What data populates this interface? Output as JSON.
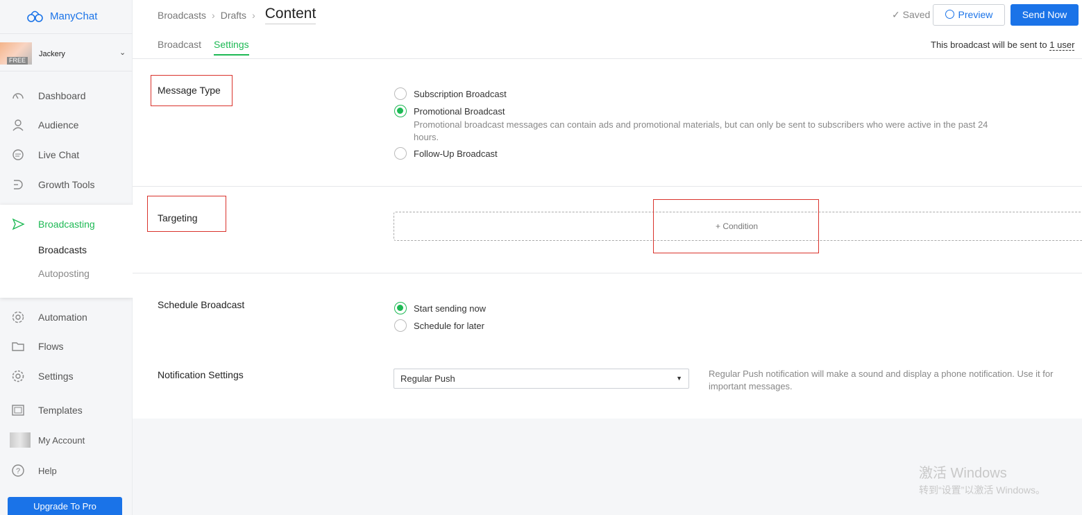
{
  "brand": {
    "name": "ManyChat",
    "color": "#1a73e8"
  },
  "account": {
    "name": "Jackery",
    "plan_badge": "FREE"
  },
  "sidebar": {
    "items": [
      {
        "label": "Dashboard",
        "icon": "dashboard-icon"
      },
      {
        "label": "Audience",
        "icon": "user-icon"
      },
      {
        "label": "Live Chat",
        "icon": "chat-icon"
      },
      {
        "label": "Growth Tools",
        "icon": "growth-tools-icon"
      },
      {
        "label": "Broadcasting",
        "icon": "send-icon"
      },
      {
        "label": "Automation",
        "icon": "automation-icon"
      },
      {
        "label": "Flows",
        "icon": "folder-icon"
      },
      {
        "label": "Settings",
        "icon": "gear-icon"
      },
      {
        "label": "Templates",
        "icon": "templates-icon"
      },
      {
        "label": "My Account",
        "icon": "account-avatar-icon"
      },
      {
        "label": "Help",
        "icon": "help-icon"
      }
    ],
    "broadcasting_sub": [
      "Broadcasts",
      "Autoposting"
    ],
    "upgrade_label": "Upgrade To Pro"
  },
  "header": {
    "breadcrumb": [
      "Broadcasts",
      "Drafts"
    ],
    "current": "Content",
    "tabs": [
      "Broadcast",
      "Settings"
    ],
    "active_tab": "Settings",
    "saved_label": "Saved",
    "preview_label": "Preview",
    "send_label": "Send Now",
    "sent_to_prefix": "This broadcast will be sent to",
    "sent_to_value": "1 user"
  },
  "message_type": {
    "label": "Message Type",
    "options": [
      "Subscription Broadcast",
      "Promotional Broadcast",
      "Follow-Up Broadcast"
    ],
    "selected": "Promotional Broadcast",
    "promo_desc": "Promotional broadcast messages can contain ads and promotional materials, but can only be sent to subscribers who were active in the past 24 hours."
  },
  "targeting": {
    "label": "Targeting",
    "condition_label": "+ Condition"
  },
  "schedule": {
    "label": "Schedule Broadcast",
    "options": [
      "Start sending now",
      "Schedule for later"
    ],
    "selected": "Start sending now"
  },
  "notification": {
    "label": "Notification Settings",
    "value": "Regular Push",
    "desc": "Regular Push notification will make a sound and display a phone notification. Use it for important messages."
  },
  "watermark": {
    "line1": "激活 Windows",
    "line2": "转到“设置”以激活 Windows。"
  },
  "colors": {
    "accent_green": "#1db954",
    "primary_blue": "#1a73e8",
    "annotation_red": "#d9322b"
  }
}
